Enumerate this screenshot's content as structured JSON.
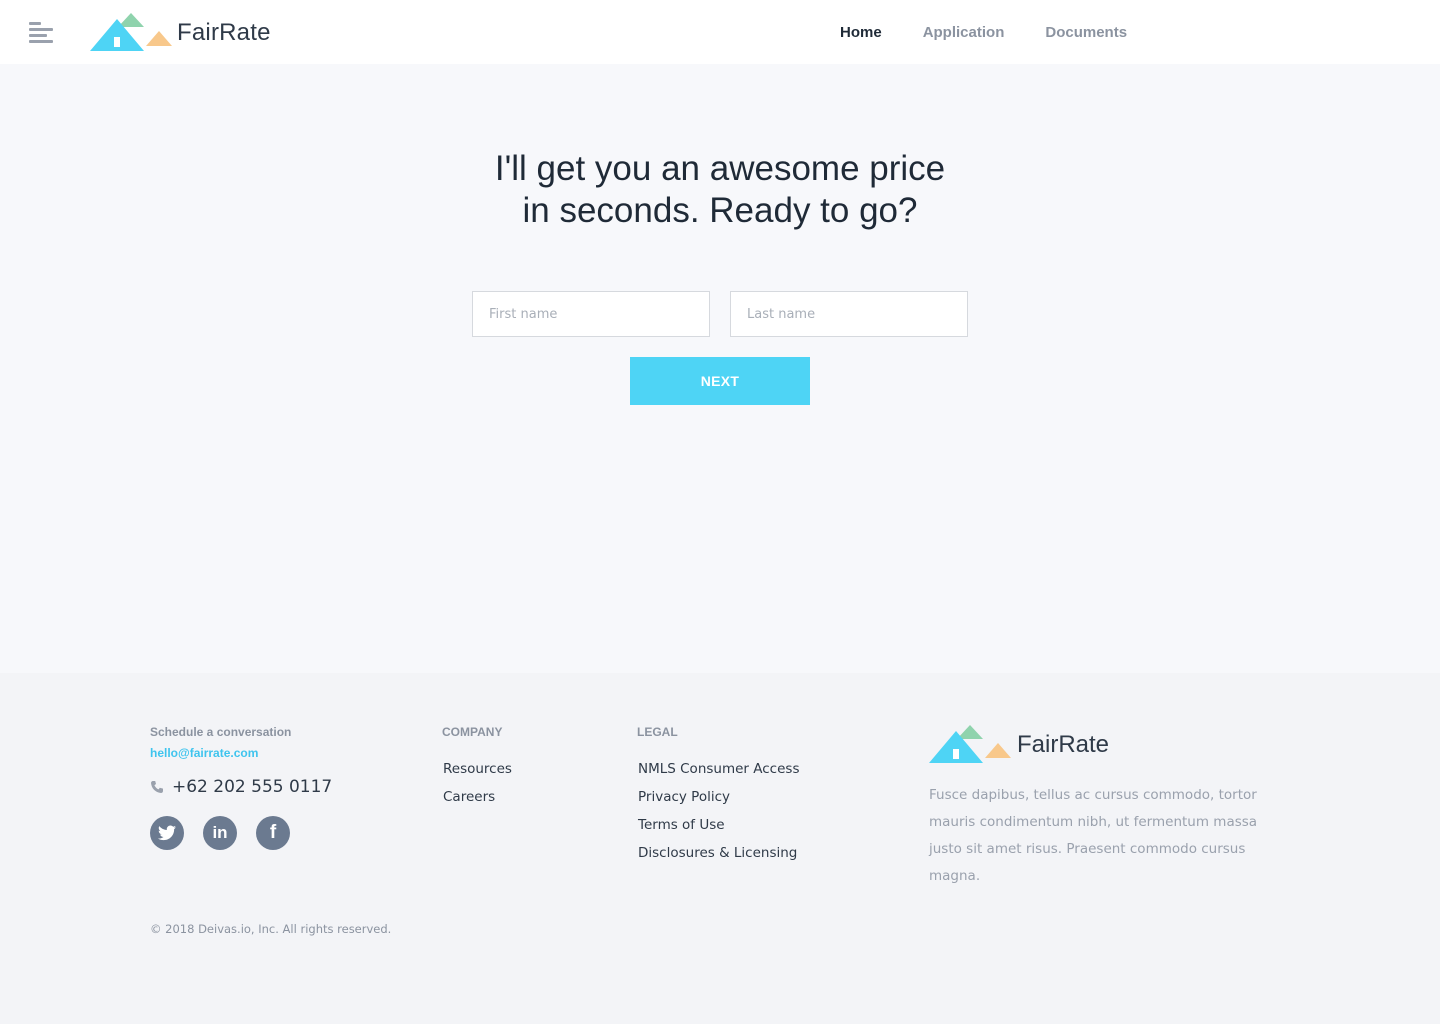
{
  "colors": {
    "accent": "#4ed4f5",
    "link": "#3fc4ee",
    "heading": "#1f2a37",
    "muted": "#8b93a0",
    "logo_blue": "#4ed4f5",
    "logo_green": "#8fd3ad",
    "logo_orange": "#f8c88b",
    "social_bg": "#6b7a90"
  },
  "header": {
    "brand": "FairRate",
    "nav": [
      {
        "label": "Home",
        "active": true
      },
      {
        "label": "Application",
        "active": false
      },
      {
        "label": "Documents",
        "active": false
      }
    ]
  },
  "hero": {
    "title_line1": "I'll get you an awesome price",
    "title_line2": "in seconds. Ready to go?",
    "first_name_placeholder": "First name",
    "first_name_value": "",
    "last_name_placeholder": "Last name",
    "last_name_value": "",
    "next_label": "NEXT"
  },
  "footer": {
    "contact": {
      "heading": "Schedule a conversation",
      "email": "hello@fairrate.com",
      "phone": "+62 202 555 0117",
      "socials": [
        {
          "name": "twitter",
          "glyph": "t"
        },
        {
          "name": "linkedin",
          "glyph": "in"
        },
        {
          "name": "facebook",
          "glyph": "f"
        }
      ]
    },
    "company": {
      "heading": "COMPANY",
      "links": [
        "Resources",
        "Careers"
      ]
    },
    "legal": {
      "heading": "LEGAL",
      "links": [
        "NMLS Consumer Access",
        "Privacy Policy",
        "Terms of Use",
        "Disclosures & Licensing"
      ]
    },
    "brand": "FairRate",
    "description": "Fusce dapibus, tellus ac cursus commodo, tortor mauris condimentum nibh, ut fermentum massa justo sit amet risus. Praesent commodo cursus magna.",
    "copyright": "© 2018 Deivas.io, Inc. All rights reserved."
  }
}
